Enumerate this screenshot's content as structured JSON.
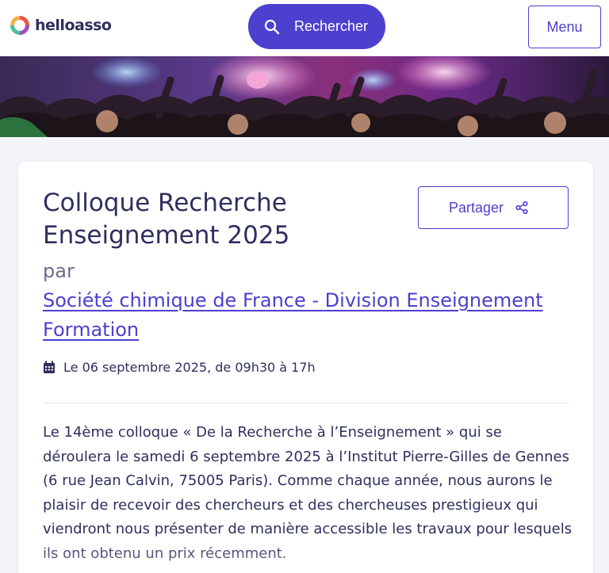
{
  "header": {
    "logo_text": "helloasso",
    "search_label": "Rechercher",
    "menu_label": "Menu"
  },
  "banner": {
    "image": "concert-crowd-photo"
  },
  "event": {
    "title": "Colloque Recherche Enseignement 2025",
    "share_label": "Partager",
    "by_label": "par",
    "organizer": "Société chimique de France - Division Enseignement Formation",
    "date": "Le 06 septembre 2025, de 09h30 à 17h",
    "description": "Le 14ème colloque « De la Recherche à l’Enseignement » qui se déroulera le samedi 6 septembre 2025 à l’Institut Pierre-Gilles de Gennes (6 rue Jean Calvin, 75005 Paris). Comme chaque année, nous aurons le plaisir de recevoir des chercheurs et des chercheuses prestigieux qui viendront nous présenter de manière accessible les travaux pour lesquels ils ont obtenu un prix récemment."
  },
  "colors": {
    "brand": "#4c40cf",
    "text": "#2e2f5e",
    "muted": "#6b6d8c",
    "background": "#f4f5fb"
  },
  "icons": [
    "logo-mark-icon",
    "search-icon",
    "share-icon",
    "calendar-icon"
  ]
}
